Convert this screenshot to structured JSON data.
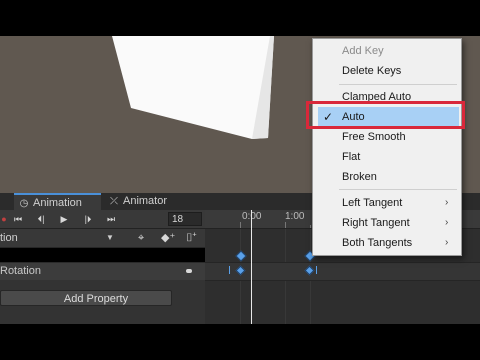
{
  "tabs": {
    "animation_label": "Animation",
    "animator_label": "Animator"
  },
  "toolbar": {
    "frame_value": "18",
    "icons": [
      "record-dot",
      "skip-start",
      "prev-key",
      "play",
      "next-key",
      "skip-end"
    ]
  },
  "clip": {
    "name_partial": "tion"
  },
  "properties": {
    "rotation_label_partial": "Rotation",
    "add_property_label": "Add Property"
  },
  "timeline": {
    "ruler_labels": [
      "0:00",
      "1:00"
    ]
  },
  "context_menu": {
    "items": [
      {
        "label": "Add Key",
        "disabled": true
      },
      {
        "label": "Delete Keys",
        "disabled": false
      },
      {
        "label": "Clamped Auto",
        "disabled": false
      },
      {
        "label": "Auto",
        "selected": true
      },
      {
        "label": "Free Smooth",
        "disabled": false
      },
      {
        "label": "Flat",
        "disabled": false
      },
      {
        "label": "Broken",
        "disabled": false
      },
      {
        "label": "Left Tangent",
        "submenu": true
      },
      {
        "label": "Right Tangent",
        "submenu": true
      },
      {
        "label": "Both Tangents",
        "submenu": true
      }
    ]
  },
  "colors": {
    "highlight": "#d9283a",
    "selected_item": "#a8d0f5",
    "keyframe": "#5aa0e8"
  }
}
